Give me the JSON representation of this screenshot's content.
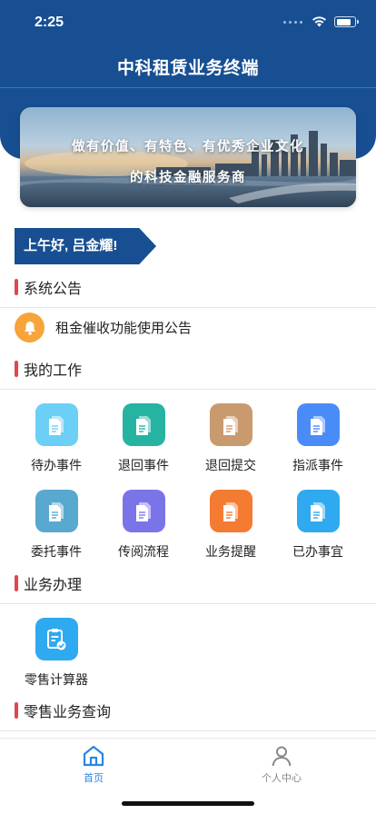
{
  "status_bar": {
    "time": "2:25"
  },
  "header": {
    "title": "中科租赁业务终端"
  },
  "banner": {
    "line1": "做有价值、有特色、有优秀企业文化",
    "line2": "的科技金融服务商"
  },
  "greeting": "上午好, 吕金耀!",
  "announcements": {
    "title": "系统公告",
    "items": [
      {
        "text": "租金催收功能使用公告",
        "icon": "bell-icon"
      }
    ]
  },
  "my_work": {
    "title": "我的工作",
    "items": [
      {
        "label": "待办事件",
        "color": "#6ccff6"
      },
      {
        "label": "退回事件",
        "color": "#27b3a2"
      },
      {
        "label": "退回提交",
        "color": "#c99a6e"
      },
      {
        "label": "指派事件",
        "color": "#4a8cf7"
      },
      {
        "label": "委托事件",
        "color": "#58a8cf"
      },
      {
        "label": "传阅流程",
        "color": "#7b74e8"
      },
      {
        "label": "业务提醒",
        "color": "#f47b32"
      },
      {
        "label": "已办事宜",
        "color": "#2fa9f0"
      }
    ]
  },
  "business": {
    "title": "业务办理",
    "items": [
      {
        "label": "零售计算器",
        "color": "#2fa9f0",
        "icon": "calculator-clipboard-icon"
      }
    ]
  },
  "retail_query": {
    "title": "零售业务查询"
  },
  "tabbar": {
    "items": [
      {
        "label": "首页",
        "icon": "home-icon",
        "active": true
      },
      {
        "label": "个人中心",
        "icon": "user-icon",
        "active": false
      }
    ],
    "active_color": "#2b85e4",
    "inactive_color": "#888888"
  },
  "colors": {
    "header": "#174f92",
    "section_bar": "#e0474c",
    "notice_icon": "#f6a53a"
  }
}
